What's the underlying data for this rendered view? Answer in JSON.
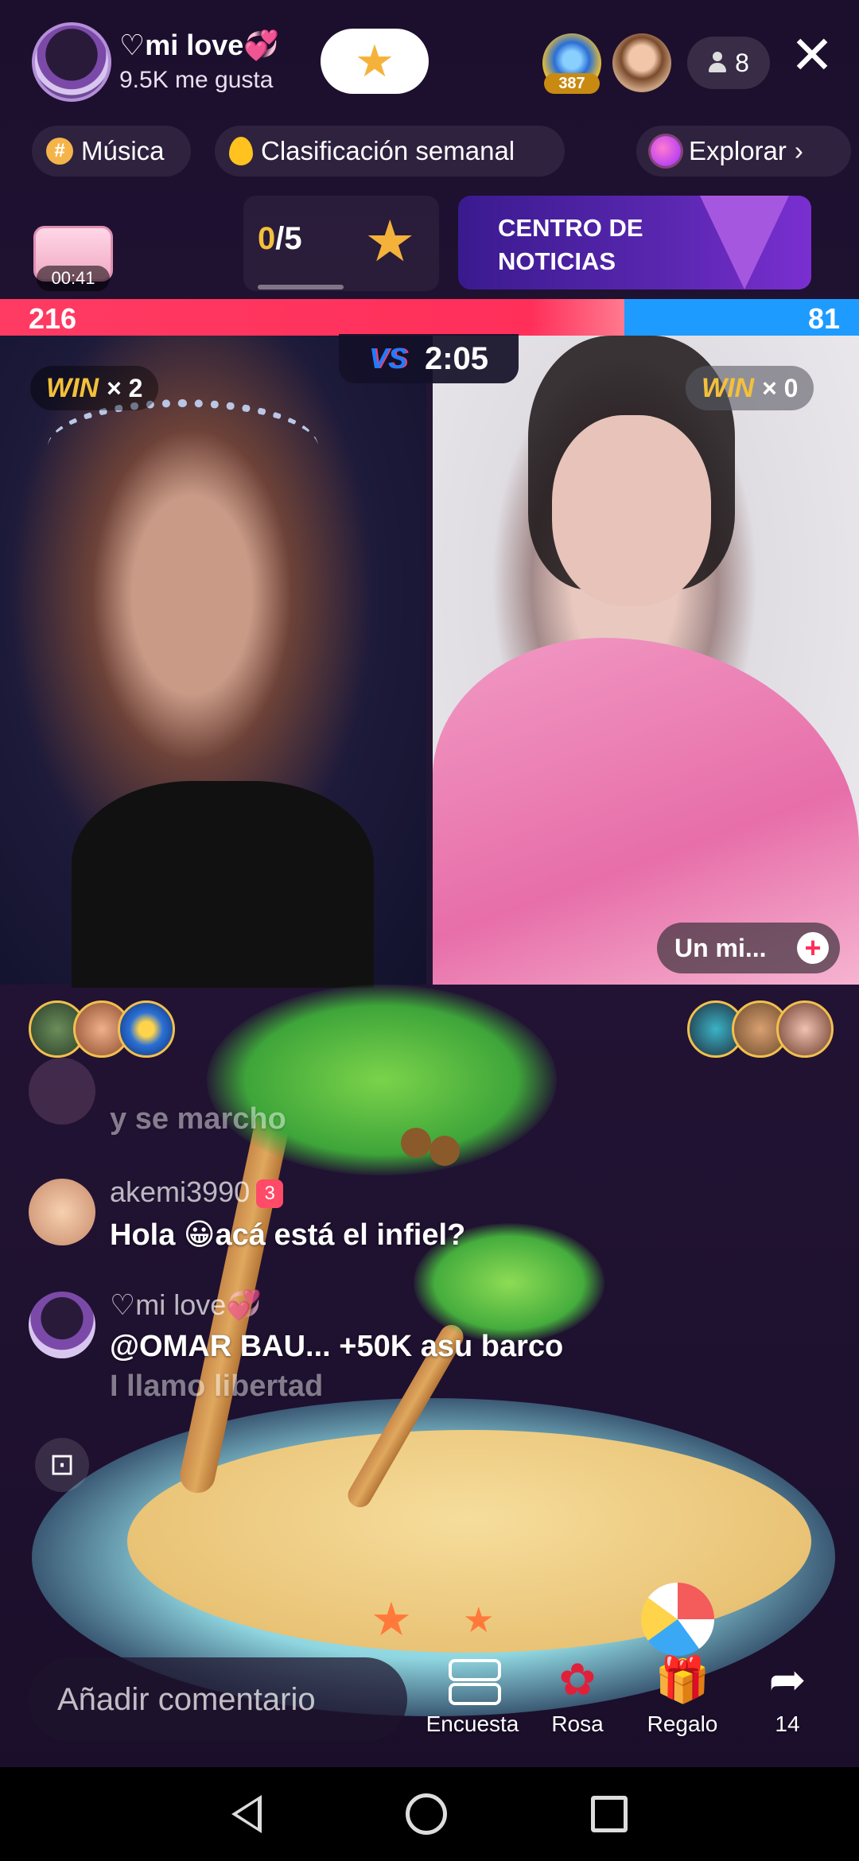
{
  "header": {
    "host_name": "♡mi love💞",
    "host_likes": "9.5K me gusta",
    "viewer1_badge": "387",
    "viewer_count": "8",
    "close_icon": "close-icon"
  },
  "chips": {
    "music": "Música",
    "weekly_ranking": "Clasificación semanal",
    "explore": "Explorar"
  },
  "treasure": {
    "timer": "00:41"
  },
  "tasks": {
    "done": "0",
    "total": "/5"
  },
  "news": {
    "line1": "CENTRO DE",
    "line2": "NOTICIAS"
  },
  "battle": {
    "score_left": "216",
    "score_right": "81",
    "score_left_fraction": 0.7272,
    "vs": "VS",
    "timer": "2:05",
    "win_label": "WIN",
    "win_left": "× 2",
    "win_right": "× 0",
    "colors": {
      "left": "#ff2f5a",
      "right": "#1e9bff"
    }
  },
  "right_panel": {
    "mini_label": "Un mi..."
  },
  "chat": [
    {
      "user": "",
      "message": "y se marcho"
    },
    {
      "user": "akemi3990",
      "level": "3",
      "message": "Hola 😀acá está el infiel?"
    },
    {
      "user": "♡mi love💞",
      "message": "@OMAR BAU... +50K asu barco",
      "message2": "I llamo libertad"
    }
  ],
  "bottom": {
    "comment_placeholder": "Añadir comentario",
    "poll_label": "Encuesta",
    "rose_label": "Rosa",
    "gift_label": "Regalo",
    "share_count": "14"
  }
}
